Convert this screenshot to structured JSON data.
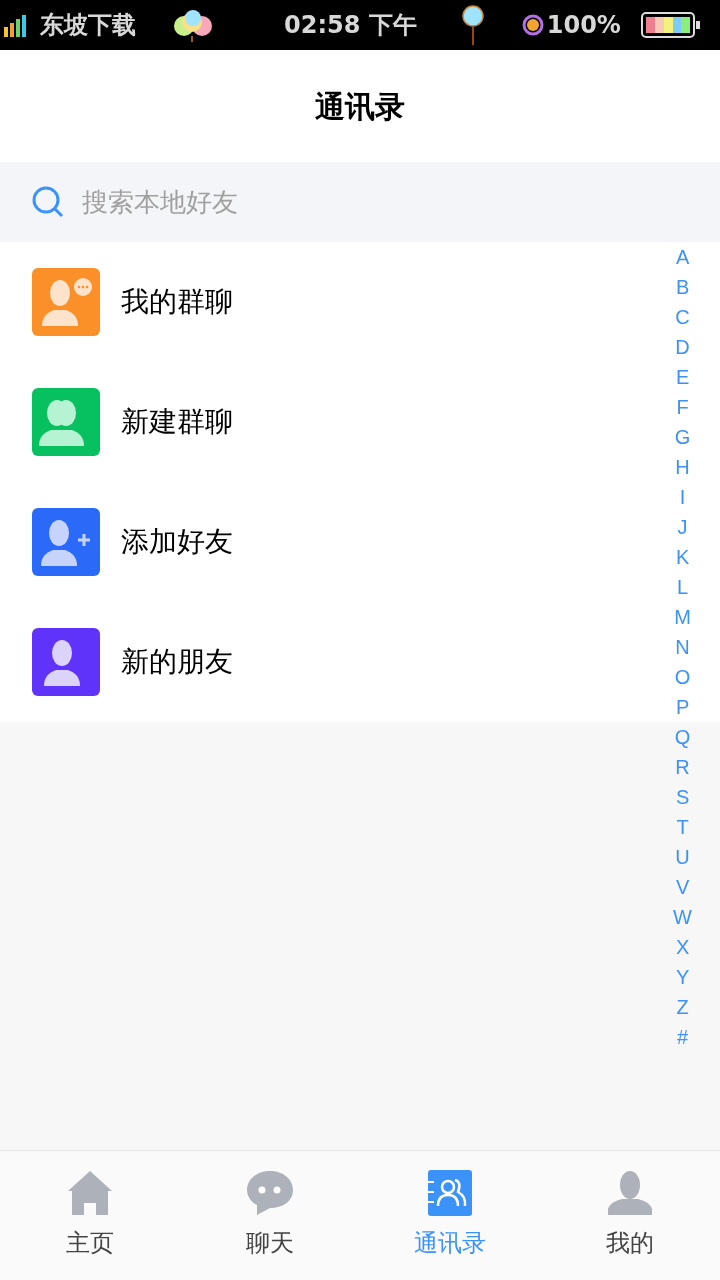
{
  "status_bar": {
    "carrier": "东坡下载",
    "time": "02:58 下午",
    "battery": "100%"
  },
  "header": {
    "title": "通讯录"
  },
  "search": {
    "placeholder": "搜索本地好友"
  },
  "entries": [
    {
      "kind": "group-chat",
      "label": "我的群聊",
      "color": "#fb9029"
    },
    {
      "kind": "new-group",
      "label": "新建群聊",
      "color": "#07c160"
    },
    {
      "kind": "add-friend",
      "label": "添加好友",
      "color": "#2b6af8"
    },
    {
      "kind": "new-friend",
      "label": "新的朋友",
      "color": "#5f33f9"
    }
  ],
  "index": [
    "A",
    "B",
    "C",
    "D",
    "E",
    "F",
    "G",
    "H",
    "I",
    "J",
    "K",
    "L",
    "M",
    "N",
    "O",
    "P",
    "Q",
    "R",
    "S",
    "T",
    "U",
    "V",
    "W",
    "X",
    "Y",
    "Z",
    "#"
  ],
  "tabs": [
    {
      "kind": "home",
      "label": "主页",
      "selected": false
    },
    {
      "kind": "chat",
      "label": "聊天",
      "selected": false
    },
    {
      "kind": "contacts",
      "label": "通讯录",
      "selected": true
    },
    {
      "kind": "me",
      "label": "我的",
      "selected": false
    }
  ]
}
